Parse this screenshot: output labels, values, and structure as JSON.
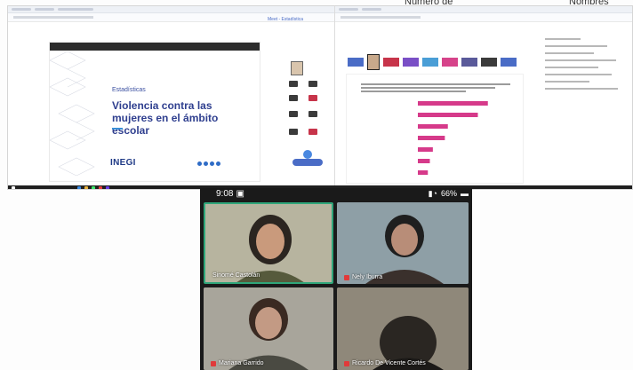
{
  "header": {
    "col1": "Número de",
    "col2": "Nombres"
  },
  "meeting": {
    "title": "Meet - Estadística"
  },
  "slide": {
    "eyebrow": "Estadísticas",
    "title": "Violencia contra las mujeres en el ámbito escolar",
    "logo": "INEGI"
  },
  "phone": {
    "time": "9:08",
    "battery": "66%",
    "participants": [
      {
        "name": "Sinomé Castolán"
      },
      {
        "name": "Nely Iburra"
      },
      {
        "name": "Mariana Garrido"
      },
      {
        "name": "Ricardo De Vicente Cortés"
      }
    ]
  },
  "chart_data": {
    "type": "bar",
    "orientation": "horizontal",
    "values": [
      70,
      60,
      30,
      27,
      15,
      12,
      10
    ],
    "xlim": [
      0,
      80
    ],
    "bar_color": "#d63a8a"
  },
  "colors": {
    "accent_blue": "#2f3f8f",
    "chart_pink": "#d63a8a",
    "active_speaker": "#2fa67a"
  }
}
